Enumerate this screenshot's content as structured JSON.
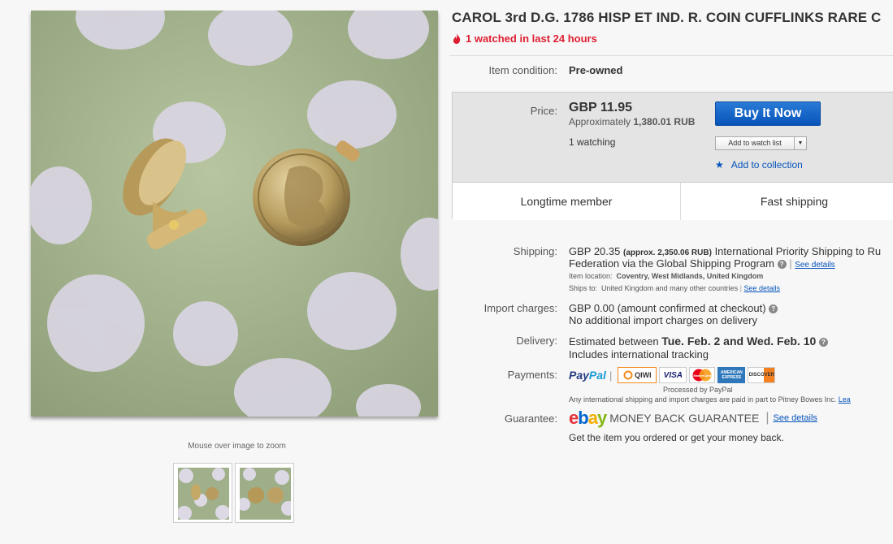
{
  "gallery": {
    "zoom_hint": "Mouse over image to zoom"
  },
  "item": {
    "title": "CAROL 3rd D.G. 1786 HISP ET IND. R. COIN CUFFLINKS RARE C",
    "watched_notice": "1 watched in last 24 hours",
    "condition_label": "Item condition:",
    "condition_value": "Pre-owned"
  },
  "price": {
    "label": "Price:",
    "amount": "GBP 11.95",
    "approx_prefix": "Approximately",
    "approx_value": "1,380.01 RUB",
    "watching": "1 watching",
    "buy_label": "Buy It Now",
    "watch_label": "Add to watch list",
    "collection_label": "Add to collection"
  },
  "badges": [
    "Longtime member",
    "Fast shipping"
  ],
  "shipping": {
    "label": "Shipping:",
    "cost": "GBP 20.35",
    "approx": "(approx. 2,350.06 RUB)",
    "service_line1": "International Priority Shipping to Ru",
    "service_line2": "Federation  via the Global Shipping Program",
    "see_details": "See details",
    "location_label": "Item location:",
    "location_value": "Coventry, West Midlands, United Kingdom",
    "ships_to_label": "Ships to:",
    "ships_to_value": "United Kingdom and many other countries",
    "ships_to_details": "See details"
  },
  "import": {
    "label": "Import charges:",
    "amount": "GBP 0.00",
    "note": "(amount confirmed at checkout)",
    "line2": "No additional import charges on delivery"
  },
  "delivery": {
    "label": "Delivery:",
    "prefix": "Estimated between",
    "dates": "Tue. Feb. 2 and Wed. Feb. 10",
    "line2": "Includes international tracking"
  },
  "payments": {
    "label": "Payments:",
    "paypal_a": "Pay",
    "paypal_b": "Pal",
    "logos": [
      "QIWI",
      "VISA",
      "MasterCard",
      "AMERICAN EXPRESS",
      "DISCOVER"
    ],
    "processed_by": "Processed by PayPal",
    "note": "Any international shipping and import charges are paid in part to Pitney Bowes Inc.",
    "note_link": "Lea"
  },
  "guarantee": {
    "label": "Guarantee:",
    "mbg_text": "MONEY BACK GUARANTEE",
    "see_details": "See details",
    "line2": "Get the item you ordered or get your money back."
  },
  "colors": {
    "alert_red": "#dd1e31",
    "link_blue": "#0654ba",
    "buy_button_blue": "#0654ba",
    "ebay_red": "#e53238",
    "ebay_blue": "#0064d2",
    "ebay_yellow": "#f5af02",
    "ebay_green": "#86b817"
  }
}
